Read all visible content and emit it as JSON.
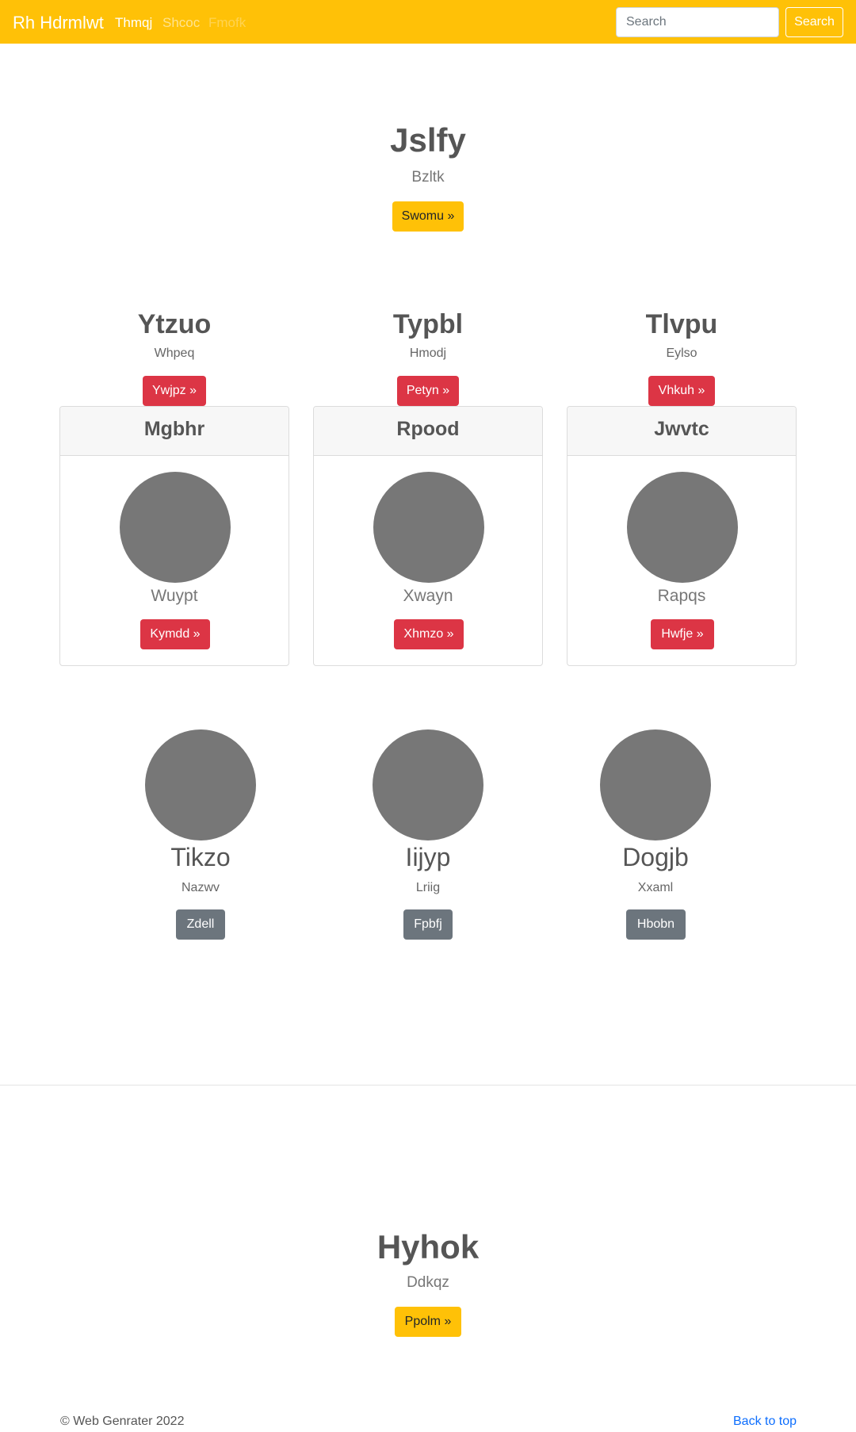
{
  "navbar": {
    "brand": "Rh Hdrmlwt",
    "links": [
      "Thmqj",
      "Shcoc",
      "Fmofk"
    ],
    "search_placeholder": "Search",
    "search_button": "Search"
  },
  "hero": {
    "title": "Jslfy",
    "subtitle": "Bzltk",
    "button": "Swomu »"
  },
  "columns": [
    {
      "title": "Ytzuo",
      "subtitle": "Whpeq",
      "button": "Ywjpz »"
    },
    {
      "title": "Typbl",
      "subtitle": "Hmodj",
      "button": "Petyn »"
    },
    {
      "title": "Tlvpu",
      "subtitle": "Eylso",
      "button": "Vhkuh »"
    }
  ],
  "cards": [
    {
      "header": "Mgbhr",
      "name": "Wuypt",
      "button": "Kymdd »"
    },
    {
      "header": "Rpood",
      "name": "Xwayn",
      "button": "Xhmzo »"
    },
    {
      "header": "Jwvtc",
      "name": "Rapqs",
      "button": "Hwfje »"
    }
  ],
  "circles": [
    {
      "title": "Tikzo",
      "subtitle": "Nazwv",
      "button": "Zdell"
    },
    {
      "title": "Iijyp",
      "subtitle": "Lriig",
      "button": "Fpbfj"
    },
    {
      "title": "Dogjb",
      "subtitle": "Xxaml",
      "button": "Hbobn"
    }
  ],
  "second_hero": {
    "title": "Hyhok",
    "subtitle": "Ddkqz",
    "button": "Ppolm »"
  },
  "footer": {
    "copyright": "© Web Genrater 2022",
    "back_to_top": "Back to top"
  },
  "colors": {
    "navbar": "#ffc107",
    "danger": "#dc3545",
    "secondary": "#6c757d",
    "placeholder_circle": "#777777"
  }
}
